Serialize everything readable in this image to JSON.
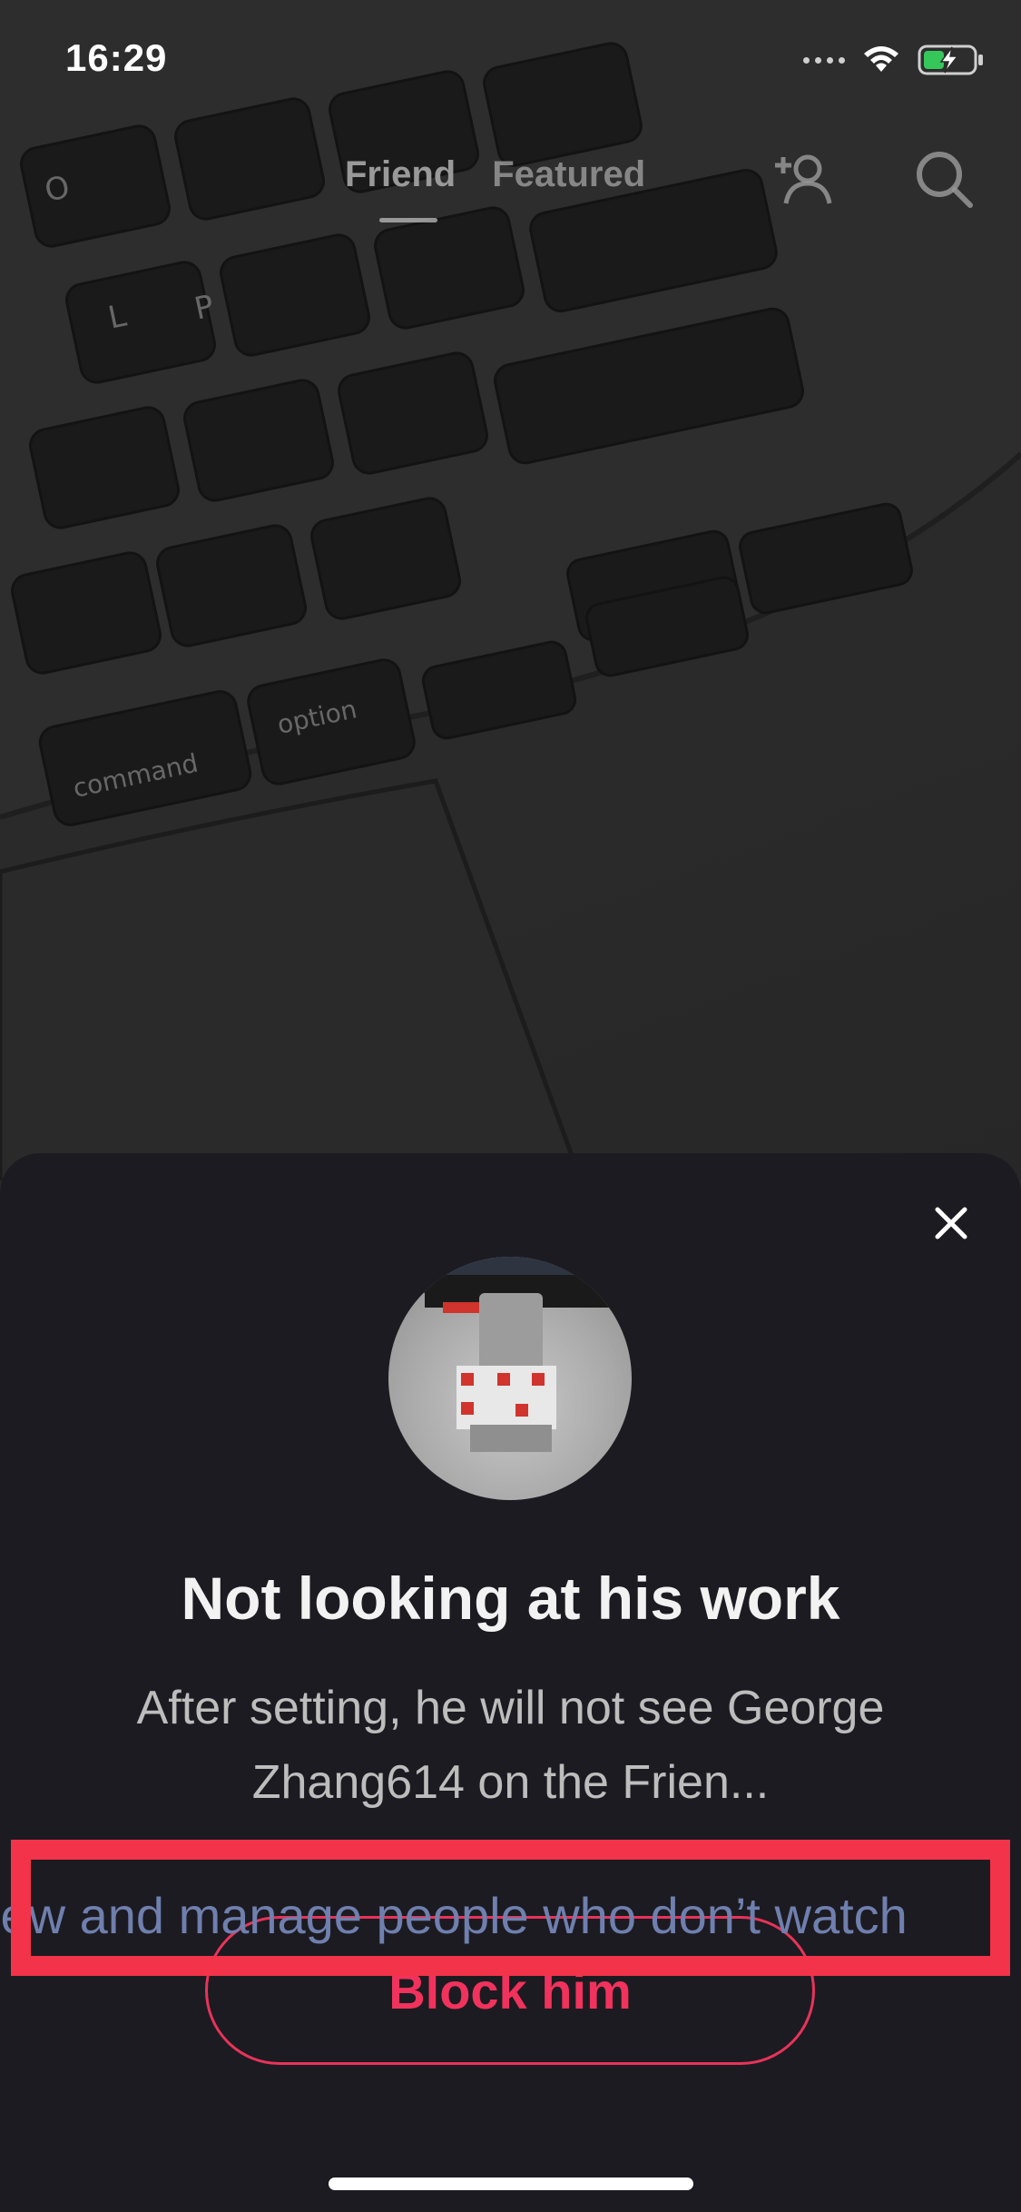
{
  "status_bar": {
    "time": "16:29"
  },
  "nav": {
    "tabs": [
      {
        "label": "Friend"
      },
      {
        "label": "Featured"
      }
    ],
    "add_friend_icon": "add-person-icon",
    "search_icon": "search-icon"
  },
  "sheet": {
    "title": "Not looking at his work",
    "description": "After setting, he will not see George Zhang614 on the Frien...",
    "manage_link": "iew and manage people who don’t watch",
    "block_button": "Block him",
    "close_icon": "close-icon"
  },
  "colors": {
    "sheet_bg": "#1c1b21",
    "accent_red": "#f0325c",
    "link_blue": "#6f7fae",
    "highlight": "#f23349"
  }
}
